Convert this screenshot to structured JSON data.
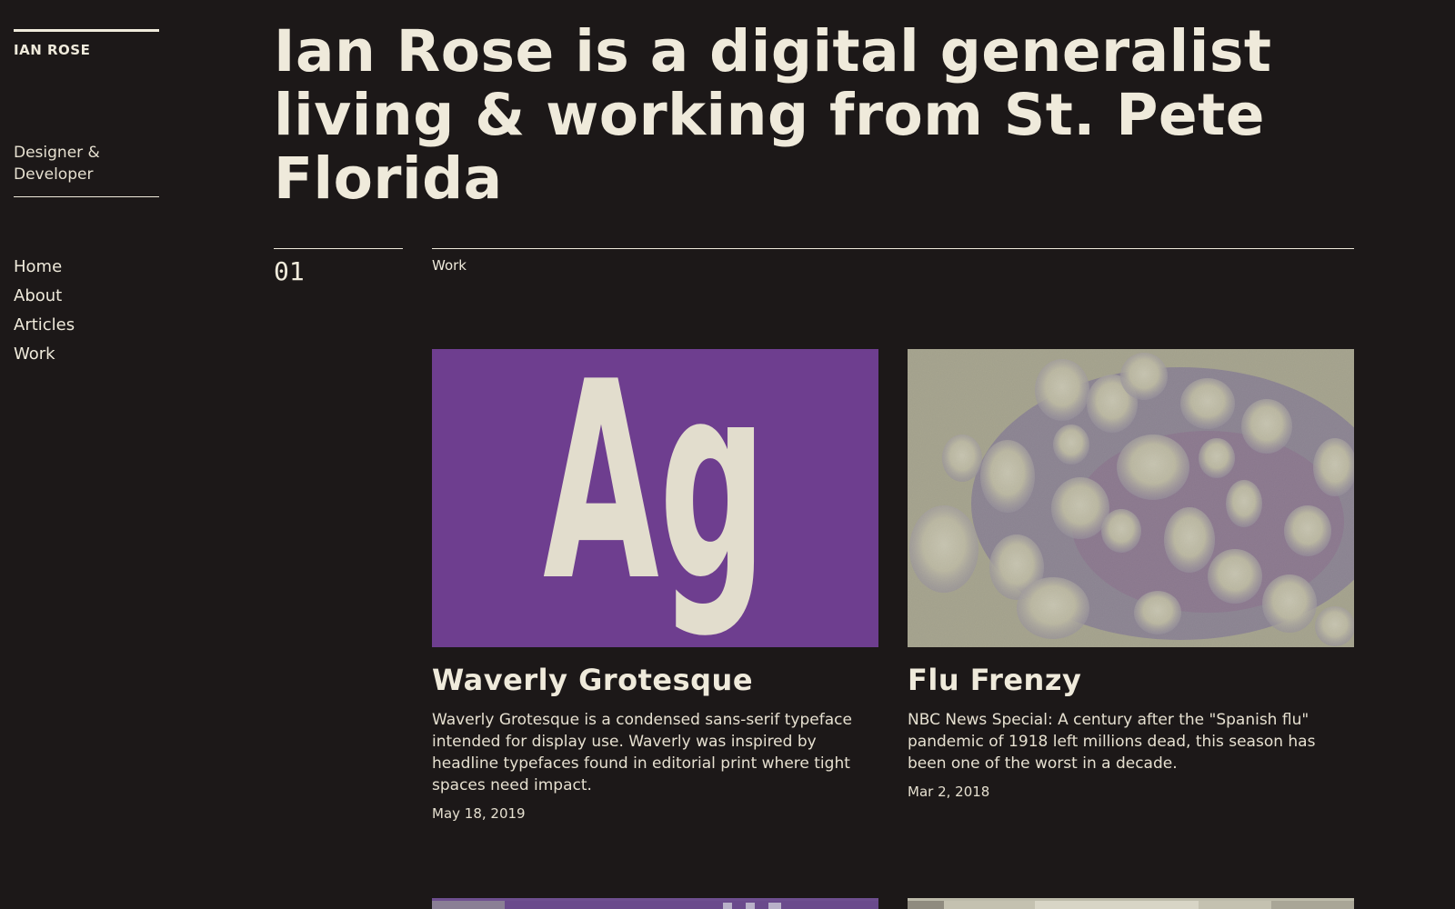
{
  "site": {
    "brand": "IAN ROSE",
    "role": "Designer & Developer"
  },
  "nav": {
    "items": [
      {
        "label": "Home"
      },
      {
        "label": "About"
      },
      {
        "label": "Articles"
      },
      {
        "label": "Work"
      }
    ]
  },
  "headline": "Ian Rose is a digital generalist living & working from St. Pete Florida",
  "section": {
    "number": "01",
    "label": "Work"
  },
  "cards": [
    {
      "title": "Waverly Grotesque",
      "image_text": "Ag",
      "description": "Waverly Grotesque is a condensed sans-serif typeface intended for display use. Waverly was inspired by headline typefaces found in editorial print where tight spaces need impact.",
      "date": "May 18, 2019"
    },
    {
      "title": "Flu Frenzy",
      "description": "NBC News Special: A century after the \"Spanish flu\" pandemic of 1918 left millions dead, this season has been one of the worst in a decade.",
      "date": "Mar 2, 2018"
    }
  ],
  "colors": {
    "background": "#1c1818",
    "text": "#efeadb",
    "waverly_purple": "#6e3e8f",
    "flu_gray": "#a8a691",
    "flu_violet": "#6a5a9c"
  }
}
